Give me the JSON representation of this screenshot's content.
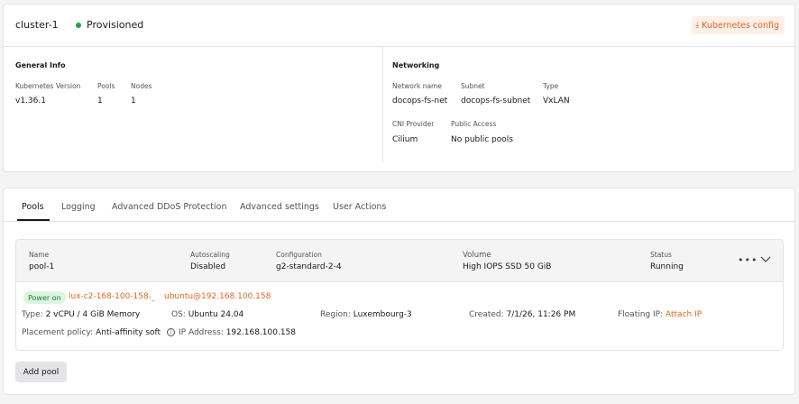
{
  "cluster": {
    "name": "cluster-1",
    "status": "Provisioned",
    "status_color": "#22a447",
    "kube_config_label": "Kubernetes config",
    "kube_config_icon": "download-icon"
  },
  "general_info": {
    "title": "General Info",
    "version_label": "Kubernetes Version",
    "version": "v1.36.1",
    "pools_label": "Pools",
    "pools": "1",
    "nodes_label": "Nodes",
    "nodes": "1"
  },
  "networking": {
    "title": "Networking",
    "network_name_label": "Network name",
    "network_name": "docops-fs-net",
    "subnet_label": "Subnet",
    "subnet": "docops-fs-subnet",
    "type_label": "Type",
    "type": "VxLAN",
    "cni_label": "CNI Provider",
    "cni": "Cilium",
    "public_access_label": "Public Access",
    "public_access": "No public pools"
  },
  "tabs": [
    {
      "label": "Pools",
      "active": true
    },
    {
      "label": "Logging",
      "active": false
    },
    {
      "label": "Advanced DDoS Protection",
      "active": false
    },
    {
      "label": "Advanced settings",
      "active": false
    },
    {
      "label": "User Actions",
      "active": false
    }
  ],
  "pool": {
    "name_label": "Name",
    "name": "pool-1",
    "autoscaling_label": "Autoscaling",
    "autoscaling": "Disabled",
    "configuration_label": "Configuration",
    "configuration": "g2-standard-2-4",
    "volume_label": "Volume",
    "volume": "High IOPS SSD 50 GiB",
    "status_label": "Status",
    "status": "Running",
    "menu_icon": "more-horizontal-icon",
    "expand_icon": "chevron-down-icon"
  },
  "node": {
    "power_state": "Power on",
    "name": "lux-c2-168-100-158",
    "terminal_icon": "terminal-icon",
    "terminal_glyph": "›_",
    "ssh": "ubuntu@192.168.100.158",
    "type_label": "Type:",
    "type": "2 vCPU / 4 GiB Memory",
    "os_label": "OS:",
    "os": "Ubuntu 24.04",
    "region_label": "Region:",
    "region": "Luxembourg-3",
    "created_label": "Created:",
    "created": "7/1/26, 11:26 PM",
    "floating_ip_label": "Floating IP:",
    "floating_ip_action": "Attach IP",
    "placement_label": "Placement policy:",
    "placement": "Anti-affinity soft",
    "ip_label": "IP Address:",
    "ip": "192.168.100.158"
  },
  "add_pool_label": "Add pool",
  "colors": {
    "accent": "#e8621e",
    "accent_bg": "#fdf0e8",
    "power_badge_bg": "#dcf5df",
    "power_badge_text": "#1f7a36"
  }
}
